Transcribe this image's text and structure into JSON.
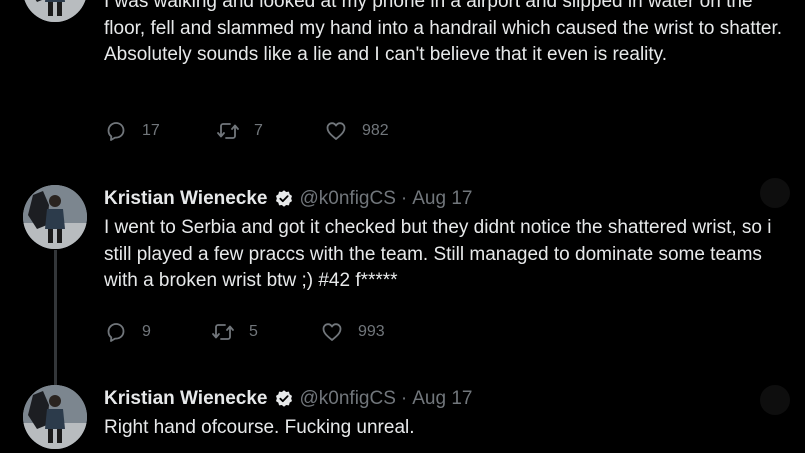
{
  "tweets": [
    {
      "text": "I was walking and looked at my phone in a airport and slipped in water on the floor, fell and slammed my hand into a handrail which caused the wrist to shatter. Absolutely sounds like a lie and I can't believe that it even is reality.",
      "replies": "17",
      "retweets": "7",
      "likes": "982"
    },
    {
      "display_name": "Kristian Wienecke",
      "handle": "@k0nfigCS",
      "separator": "·",
      "date": "Aug 17",
      "text": "I went to Serbia and got it checked but they didnt notice the shattered wrist, so i still played a few praccs with the team. Still managed to dominate some teams with a broken wrist btw ;) #42 f*****",
      "replies": "9",
      "retweets": "5",
      "likes": "993"
    },
    {
      "display_name": "Kristian Wienecke",
      "handle": "@k0nfigCS",
      "separator": "·",
      "date": "Aug 17",
      "text": "Right hand ofcourse. Fucking unreal."
    }
  ],
  "icons": {
    "reply": "speech-bubble-icon",
    "retweet": "retweet-arrows-icon",
    "like": "heart-icon",
    "verified": "verified-badge-icon"
  },
  "colors": {
    "background": "#000000",
    "text": "#e7e9ea",
    "muted": "#71767b",
    "verified_badge": "#e7e9ea"
  }
}
